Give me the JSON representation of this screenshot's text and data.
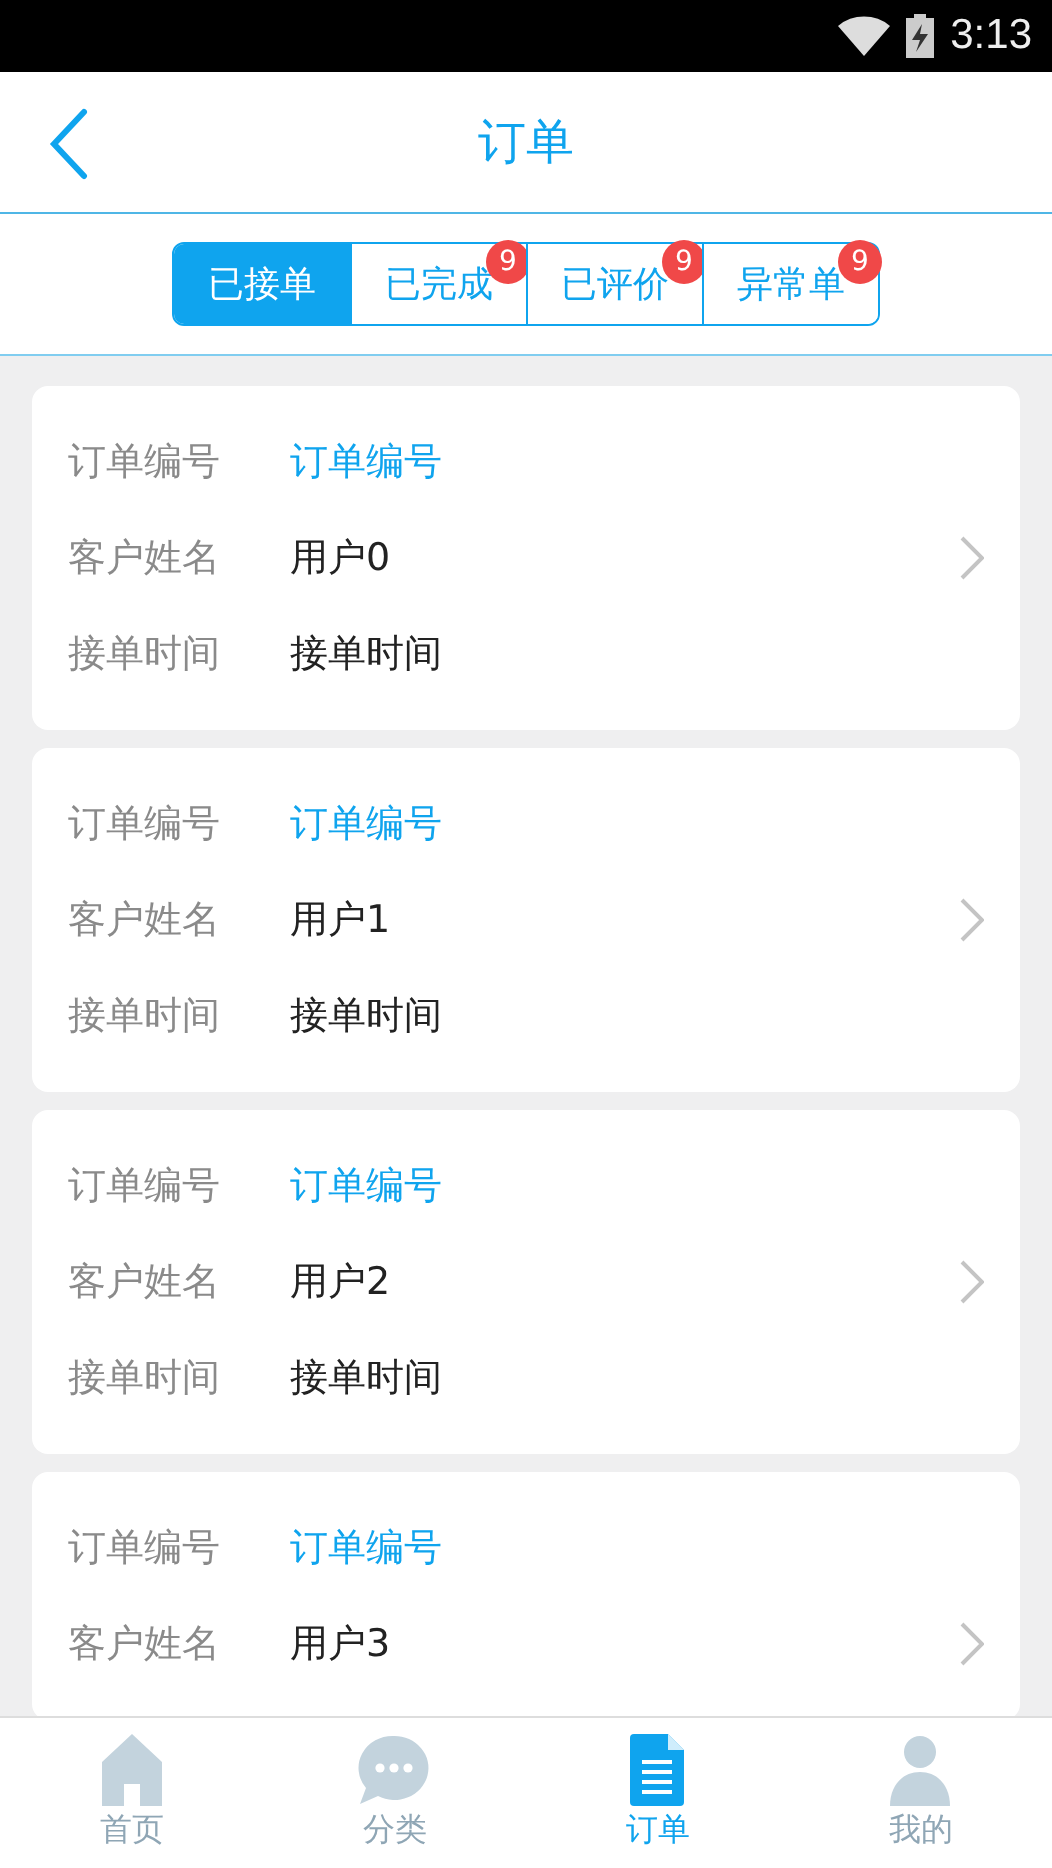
{
  "status_bar": {
    "time": "3:13"
  },
  "header": {
    "title": "订单"
  },
  "tabs": [
    {
      "label": "已接单",
      "selected": true
    },
    {
      "label": "已完成",
      "selected": false,
      "badge": "9"
    },
    {
      "label": "已评价",
      "selected": false,
      "badge": "9"
    },
    {
      "label": "异常单",
      "selected": false,
      "badge": "9"
    }
  ],
  "orders": [
    {
      "fields": [
        {
          "label": "订单编号",
          "value": "订单编号",
          "kind": "link"
        },
        {
          "label": "客户姓名",
          "value": "用户0",
          "kind": "plain",
          "chevron": true
        },
        {
          "label": "接单时间",
          "value": "接单时间",
          "kind": "plain"
        }
      ]
    },
    {
      "fields": [
        {
          "label": "订单编号",
          "value": "订单编号",
          "kind": "link"
        },
        {
          "label": "客户姓名",
          "value": "用户1",
          "kind": "plain",
          "chevron": true
        },
        {
          "label": "接单时间",
          "value": "接单时间",
          "kind": "plain"
        }
      ]
    },
    {
      "fields": [
        {
          "label": "订单编号",
          "value": "订单编号",
          "kind": "link"
        },
        {
          "label": "客户姓名",
          "value": "用户2",
          "kind": "plain",
          "chevron": true
        },
        {
          "label": "接单时间",
          "value": "接单时间",
          "kind": "plain"
        }
      ]
    },
    {
      "fields": [
        {
          "label": "订单编号",
          "value": "订单编号",
          "kind": "link"
        },
        {
          "label": "客户姓名",
          "value": "用户3",
          "kind": "plain",
          "chevron": true
        }
      ]
    }
  ],
  "bottom_nav": [
    {
      "label": "首页",
      "kind": "home",
      "selected": false
    },
    {
      "label": "分类",
      "kind": "chat",
      "selected": false
    },
    {
      "label": "订单",
      "kind": "doc",
      "selected": true
    },
    {
      "label": "我的",
      "kind": "user",
      "selected": false
    }
  ]
}
